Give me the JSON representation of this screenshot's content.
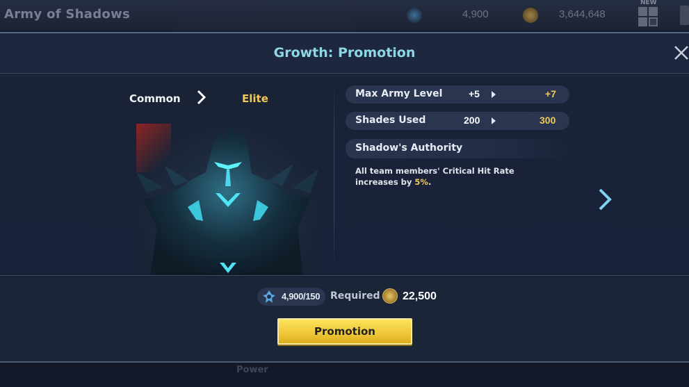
{
  "topbar": {
    "title": "Army of Shadows",
    "shade_essence": "4,900",
    "gold": "3,644,648",
    "new_badge": "NEW"
  },
  "modal": {
    "title": "Growth: Promotion",
    "rank": {
      "from": "Common",
      "to": "Elite"
    },
    "stats": [
      {
        "label": "Max Army Level",
        "from": "+5",
        "to": "+7"
      },
      {
        "label": "Shades Used",
        "from": "200",
        "to": "300"
      }
    ],
    "authority": {
      "title": "Shadow's Authority",
      "desc_prefix": "All team members' Critical Hit Rate increases by ",
      "desc_value": "5%",
      "desc_suffix": "."
    },
    "cost": {
      "essence": "4,900/150",
      "required_label": "Required",
      "gold": "22,500"
    },
    "promotion_button": "Promotion"
  },
  "background": {
    "ghost_power": "Power"
  },
  "colors": {
    "accent_title": "#8fd7e4",
    "highlight": "#f1c85a",
    "button": "#f0c93a"
  }
}
